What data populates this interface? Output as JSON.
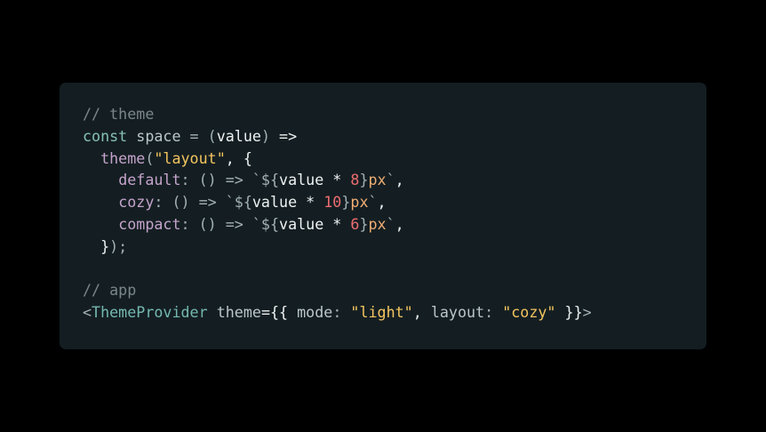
{
  "colors": {
    "background": "#000000",
    "card": "#141e22",
    "comment": "#7b868b",
    "keyword": "#87c1b4",
    "identifier": "#bac6cb",
    "punctuation": "#a3b1b6",
    "bright": "#eef2f3",
    "property": "#c4a3cb",
    "string": "#f3c55f",
    "number": "#ec6d70",
    "template": "#f0ae74",
    "component": "#74b8b0"
  },
  "code": {
    "lines": [
      [
        {
          "t": "// theme",
          "c": "comment"
        }
      ],
      [
        {
          "t": "const ",
          "c": "keyword"
        },
        {
          "t": "space",
          "c": "identifier"
        },
        {
          "t": " = ",
          "c": "punctuation"
        },
        {
          "t": "(",
          "c": "punctuation"
        },
        {
          "t": "value",
          "c": "bright"
        },
        {
          "t": ") ",
          "c": "punctuation"
        },
        {
          "t": "=>",
          "c": "bright"
        }
      ],
      [
        {
          "t": "  ",
          "c": "punctuation"
        },
        {
          "t": "theme",
          "c": "property"
        },
        {
          "t": "(",
          "c": "punctuation"
        },
        {
          "t": "\"layout\"",
          "c": "string"
        },
        {
          "t": ", {",
          "c": "bright"
        }
      ],
      [
        {
          "t": "    ",
          "c": "punctuation"
        },
        {
          "t": "default",
          "c": "property"
        },
        {
          "t": ": () => ",
          "c": "punctuation"
        },
        {
          "t": "`${",
          "c": "punctuation"
        },
        {
          "t": "value * ",
          "c": "bright"
        },
        {
          "t": "8",
          "c": "number"
        },
        {
          "t": "}",
          "c": "punctuation"
        },
        {
          "t": "px",
          "c": "template"
        },
        {
          "t": "`",
          "c": "punctuation"
        },
        {
          "t": ",",
          "c": "bright"
        }
      ],
      [
        {
          "t": "    ",
          "c": "punctuation"
        },
        {
          "t": "cozy",
          "c": "property"
        },
        {
          "t": ": () => ",
          "c": "punctuation"
        },
        {
          "t": "`${",
          "c": "punctuation"
        },
        {
          "t": "value * ",
          "c": "bright"
        },
        {
          "t": "10",
          "c": "number"
        },
        {
          "t": "}",
          "c": "punctuation"
        },
        {
          "t": "px",
          "c": "template"
        },
        {
          "t": "`",
          "c": "punctuation"
        },
        {
          "t": ",",
          "c": "bright"
        }
      ],
      [
        {
          "t": "    ",
          "c": "punctuation"
        },
        {
          "t": "compact",
          "c": "property"
        },
        {
          "t": ": () => ",
          "c": "punctuation"
        },
        {
          "t": "`${",
          "c": "punctuation"
        },
        {
          "t": "value * ",
          "c": "bright"
        },
        {
          "t": "6",
          "c": "number"
        },
        {
          "t": "}",
          "c": "punctuation"
        },
        {
          "t": "px",
          "c": "template"
        },
        {
          "t": "`",
          "c": "punctuation"
        },
        {
          "t": ",",
          "c": "bright"
        }
      ],
      [
        {
          "t": "  ",
          "c": "punctuation"
        },
        {
          "t": "}",
          "c": "bright"
        },
        {
          "t": ");",
          "c": "punctuation"
        }
      ],
      [],
      [
        {
          "t": "// app",
          "c": "comment"
        }
      ],
      [
        {
          "t": "<",
          "c": "punctuation"
        },
        {
          "t": "ThemeProvider",
          "c": "component"
        },
        {
          "t": " ",
          "c": "punctuation"
        },
        {
          "t": "theme",
          "c": "identifier"
        },
        {
          "t": "={{ ",
          "c": "bright"
        },
        {
          "t": "mode",
          "c": "identifier"
        },
        {
          "t": ": ",
          "c": "punctuation"
        },
        {
          "t": "\"light\"",
          "c": "string"
        },
        {
          "t": ", ",
          "c": "bright"
        },
        {
          "t": "layout",
          "c": "identifier"
        },
        {
          "t": ": ",
          "c": "punctuation"
        },
        {
          "t": "\"cozy\"",
          "c": "string"
        },
        {
          "t": " }}",
          "c": "bright"
        },
        {
          "t": ">",
          "c": "punctuation"
        }
      ]
    ]
  }
}
